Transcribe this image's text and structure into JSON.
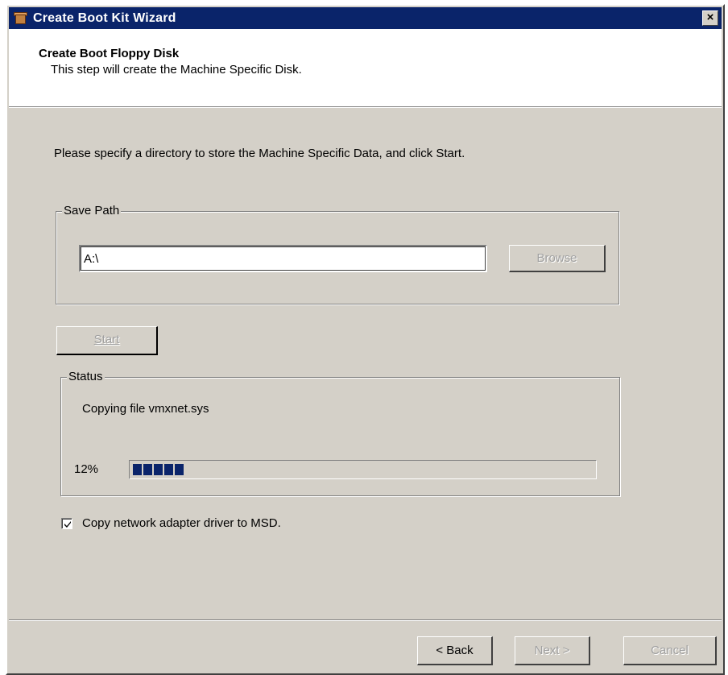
{
  "window": {
    "title": "Create Boot Kit Wizard",
    "close_label": "×"
  },
  "header": {
    "title": "Create Boot Floppy Disk",
    "subtitle": "This step will create the Machine Specific Disk."
  },
  "instructions": "Please specify a directory to store the Machine Specific Data, and click Start.",
  "save_path": {
    "group_label": "Save Path",
    "value": "A:\\",
    "browse_label": "Browse"
  },
  "start_label": "Start",
  "status": {
    "group_label": "Status",
    "message": "Copying file vmxnet.sys",
    "percent_text": "12%",
    "progress": 0.12
  },
  "option": {
    "label": "Copy network adapter driver to MSD.",
    "checked": true
  },
  "footer": {
    "back_label": "< Back",
    "next_label": "Next >",
    "cancel_label": "Cancel"
  },
  "colors": {
    "titlebar": "#0a246a",
    "face": "#d4d0c8",
    "progress": "#0a246a"
  }
}
